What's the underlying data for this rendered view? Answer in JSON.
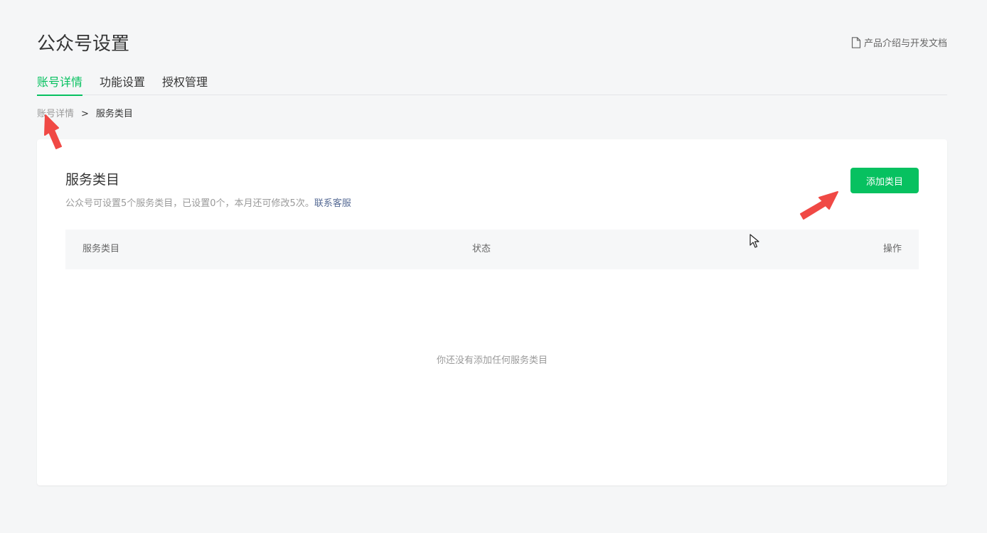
{
  "header": {
    "title": "公众号设置",
    "doc_link": "产品介绍与开发文档"
  },
  "tabs": [
    {
      "label": "账号详情",
      "active": true
    },
    {
      "label": "功能设置",
      "active": false
    },
    {
      "label": "授权管理",
      "active": false
    }
  ],
  "breadcrumb": {
    "parent": "账号详情",
    "separator": ">",
    "current": "服务类目"
  },
  "card": {
    "title": "服务类目",
    "description": "公众号可设置5个服务类目，已设置0个，本月还可修改5次。",
    "contact_link": "联系客服",
    "add_button": "添加类目",
    "table_headers": [
      "服务类目",
      "状态",
      "操作"
    ],
    "empty_text": "你还没有添加任何服务类目"
  },
  "colors": {
    "accent": "#07c160",
    "link": "#576b95",
    "annotation_arrow": "#f0403c"
  },
  "icons": [
    "document-icon",
    "annotation-arrow",
    "mouse-cursor-icon"
  ]
}
